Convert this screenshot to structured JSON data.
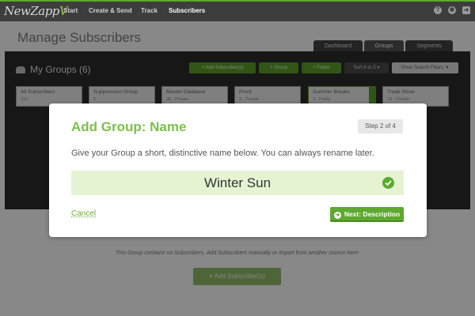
{
  "nav": {
    "logo_main": "NewZapp",
    "items": [
      "Start",
      "Create & Send",
      "Track",
      "Subscribers"
    ],
    "right_icons": [
      "help-icon",
      "settings-icon",
      "logout-icon"
    ]
  },
  "page": {
    "title": "Manage Subscribers",
    "tabs": [
      "Dashboard",
      "Groups",
      "Segments"
    ],
    "active_tab": "Groups"
  },
  "groups": {
    "title": "My Groups (6)",
    "toolbar": {
      "add_subscribers": "Add Subscriber(s)",
      "group": "Group",
      "folder": "Folder",
      "sort": "Sort A to Z",
      "filters": "Show Search Filters"
    },
    "cards": [
      {
        "name": "All Subscribers",
        "meta": "210"
      },
      {
        "name": "Suppression Group",
        "meta": "0"
      },
      {
        "name": "Master Database",
        "meta": "38 · Private"
      },
      {
        "name": "Proof",
        "meta": "3 · Private"
      },
      {
        "name": "Summer Breaks",
        "meta": "3 · Public"
      },
      {
        "name": "Trade Show",
        "meta": "78 · Private"
      }
    ],
    "empty_message": "This Group contains no Subscribers. Add Subscribers manually or import from another source here:",
    "add_subscribers_button": "Add Subscriber(s)"
  },
  "modal": {
    "title": "Add Group: Name",
    "step": "Step 2 of 4",
    "description": "Give your Group a short, distinctive name below. You can always rename later.",
    "name_value": "Winter Sun",
    "cancel": "Cancel",
    "next": "Next: Description"
  },
  "colors": {
    "accent": "#7cc04a",
    "primary_button": "#5ea82f",
    "nav_bg": "#3d3d3d",
    "field_bg": "#e5f3d2"
  }
}
